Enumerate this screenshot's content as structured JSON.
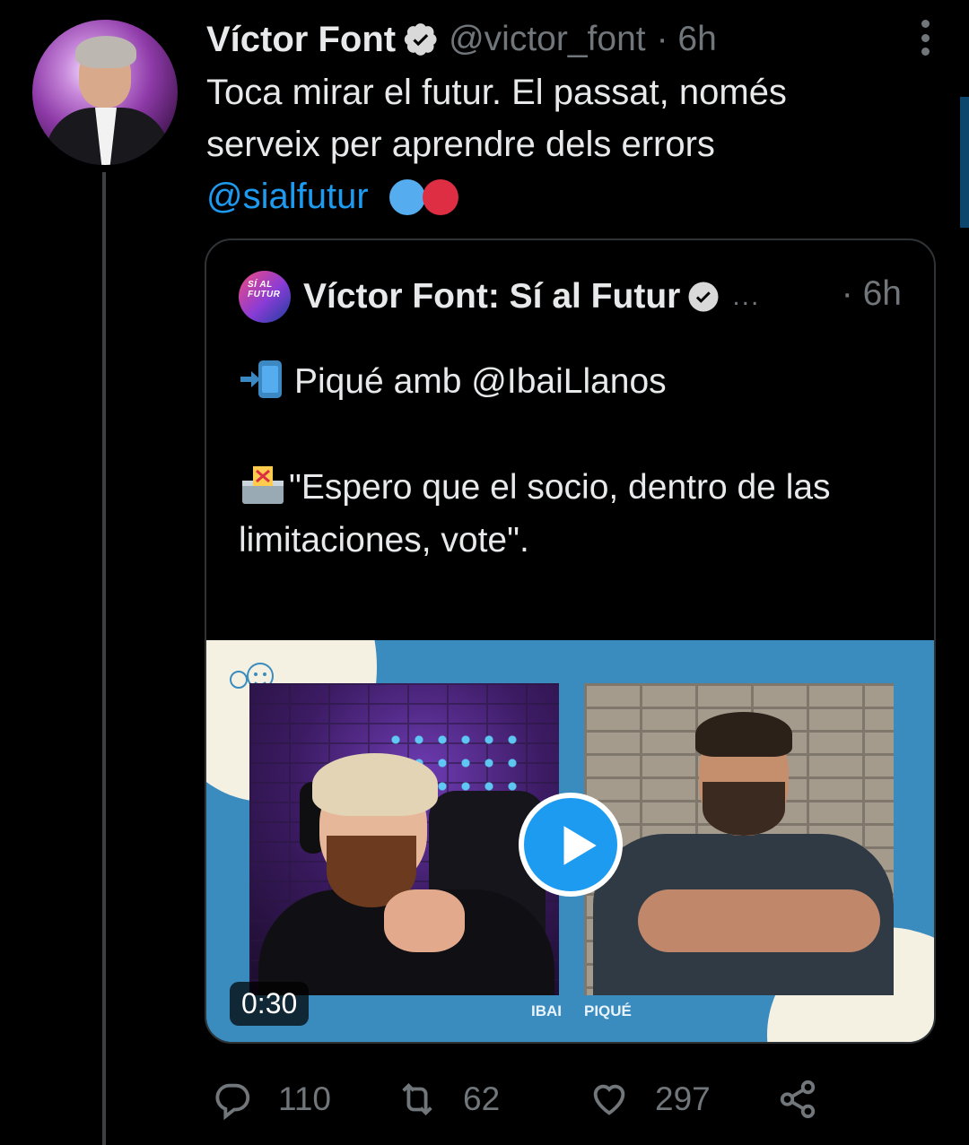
{
  "tweet": {
    "author": {
      "name": "Víctor Font",
      "handle": "@victor_font",
      "time": "· 6h"
    },
    "text_lines": [
      "Toca mirar el futur. El passat, només",
      "serveix per aprendre dels errors"
    ],
    "mention": "@sialfutur",
    "emoji_circles": [
      "blue-circle",
      "red-circle"
    ]
  },
  "quote": {
    "author": {
      "name": "Víctor Font: Sí al Futur",
      "dots": "...",
      "time": "· 6h",
      "avatar_text": "SÍ AL FUTUR"
    },
    "line1": "Piqué amb @IbaiLlanos",
    "line2": "\"Espero que el socio, dentro de las",
    "line3": "limitaciones, vote\".",
    "ellipsis": "...",
    "video": {
      "duration": "0:30",
      "labels": {
        "left": "IBAI",
        "right": "PIQUÉ"
      }
    }
  },
  "actions": {
    "reply_count": "110",
    "retweet_count": "62",
    "like_count": "297"
  },
  "colors": {
    "accent": "#1d9bf0",
    "muted": "#71767b",
    "text": "#e7e9ea",
    "background": "#000000"
  },
  "icons": [
    "verified-icon",
    "more-icon",
    "reply-icon",
    "retweet-icon",
    "like-icon",
    "share-icon",
    "play-icon"
  ]
}
